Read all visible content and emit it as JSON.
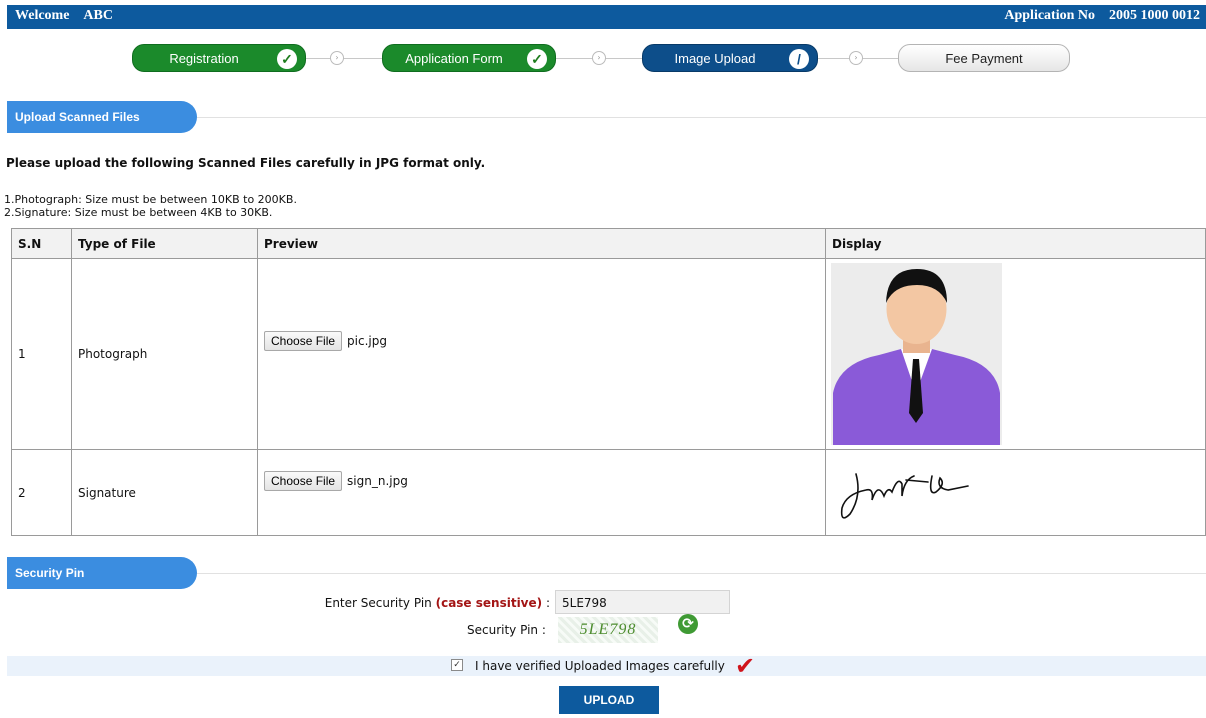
{
  "header": {
    "welcome_label": "Welcome",
    "user_name": "ABC",
    "application_label": "Application No",
    "application_number": "2005 1000 0012",
    "bar_color": "#0d5a9e"
  },
  "steps": [
    {
      "label": "Registration",
      "status": "done"
    },
    {
      "label": "Application Form",
      "status": "done"
    },
    {
      "label": "Image Upload",
      "status": "active"
    },
    {
      "label": "Fee Payment",
      "status": "pending"
    }
  ],
  "upload_section": {
    "title": "Upload Scanned Files",
    "instruction_title": "Please upload the following Scanned Files carefully in JPG format only.",
    "rules": [
      "1.Photograph: Size must be between 10KB to 200KB.",
      "2.Signature: Size must be between 4KB to 30KB."
    ]
  },
  "table": {
    "headers": [
      "S.N",
      "Type of File",
      "Preview",
      "Display"
    ],
    "rows": [
      {
        "sn": "1",
        "type": "Photograph",
        "button_label": "Choose File",
        "file_name": "pic.jpg"
      },
      {
        "sn": "2",
        "type": "Signature",
        "button_label": "Choose File",
        "file_name": "sign_n.jpg"
      }
    ]
  },
  "security": {
    "title": "Security Pin",
    "enter_label": "Enter Security Pin",
    "case_note": "(case sensitive)",
    "separator": ":",
    "pin_value": "5LE798",
    "captcha_label": "Security Pin :",
    "captcha_text": "5LE798",
    "refresh_icon": "refresh-icon",
    "verify_text": "I have verified Uploaded Images carefully",
    "verify_checked": true,
    "upload_label": "UPLOAD",
    "accent_red": "#a31515"
  }
}
